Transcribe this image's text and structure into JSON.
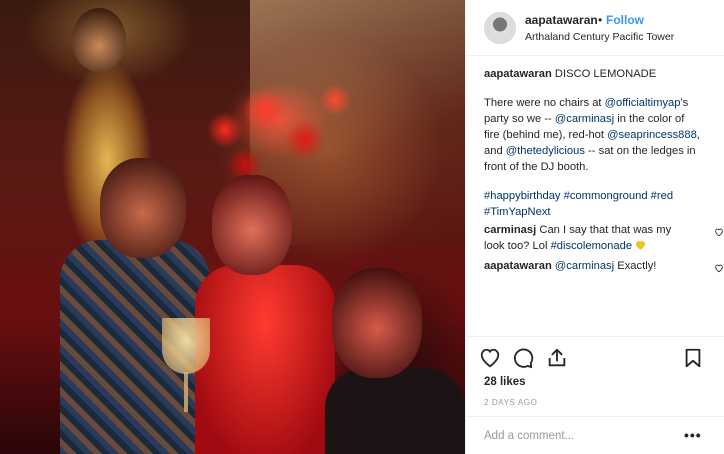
{
  "post": {
    "photo_alt": "Party photo: four people posing in red light in front of a DJ booth"
  },
  "header": {
    "username": "aapatawaran",
    "separator": "•",
    "follow_label": "Follow",
    "location": "Arthaland Century Pacific Tower"
  },
  "caption": {
    "username": "aapatawaran",
    "title": "DISCO LEMONADE",
    "line1_a": "There were no chairs at ",
    "mention1": "@officialtimyap",
    "line1_b": "'s",
    "line2_a": "party so we -- ",
    "mention2": "@carminasj",
    "line2_b": " in the color of",
    "line3_a": "fire (behind me), red-hot ",
    "mention3": "@seaprincess888",
    "line3_b": ",",
    "line4_a": "and ",
    "mention4": "@thetedylicious",
    "line4_b": " -- sat on the ledges in",
    "line5": "front of the DJ booth.",
    "hashtags_line1": "#happybirthday #commonground #red",
    "hashtags_line2": "#TimYapNext"
  },
  "comments": [
    {
      "username": "carminasj",
      "text_a": " Can I say that that was my",
      "text_b": "look too? Lol ",
      "hashtag": "#discolemonade",
      "emoji": "yellow-heart"
    },
    {
      "username": "aapatawaran",
      "mention": "@carminasj",
      "text": " Exactly!"
    }
  ],
  "stats": {
    "likes": "28 likes",
    "date": "2 DAYS AGO"
  },
  "composer": {
    "placeholder": "Add a comment...",
    "more": "•••"
  },
  "colors": {
    "link": "#003569",
    "follow": "#3897f0",
    "muted": "#999999",
    "emoji_heart": "#f5c518"
  }
}
